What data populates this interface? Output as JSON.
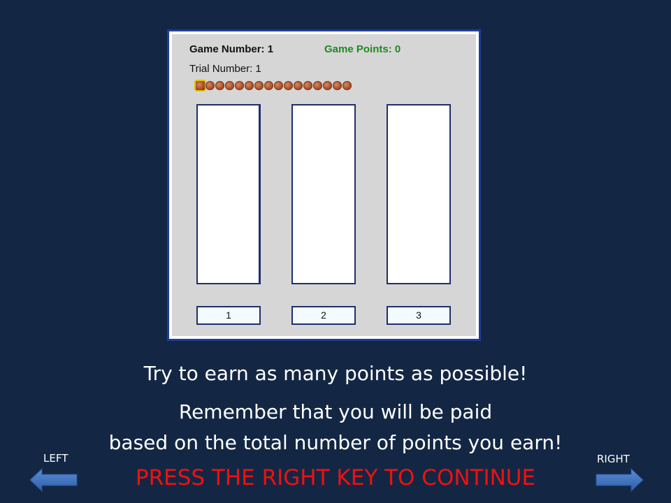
{
  "game": {
    "game_number_label": "Game Number:",
    "game_number": "1",
    "game_points_label": "Game Points:",
    "game_points": "0",
    "trial_number_label": "Trial Number:",
    "trial_number": "1",
    "trial_tokens_total": 16,
    "current_trial_index": 1
  },
  "decks": [
    {
      "label": "1"
    },
    {
      "label": "2"
    },
    {
      "label": "3"
    }
  ],
  "messages": {
    "line1": "Try to earn as many points as possible!",
    "line2": "Remember that you will be paid",
    "line3": "based on the total number of points you earn!",
    "continue": "PRESS THE RIGHT KEY TO CONTINUE"
  },
  "navigation": {
    "left_label": "LEFT",
    "right_label": "RIGHT"
  },
  "colors": {
    "background": "#132744",
    "panel_border": "#1f3d9a",
    "points_text": "#1e8a1e",
    "continue_text": "#ee1111",
    "arrow_fill": "#3d72c0"
  },
  "icons": {
    "trial_token": "coin-icon",
    "left": "left-arrow-icon",
    "right": "right-arrow-icon"
  }
}
